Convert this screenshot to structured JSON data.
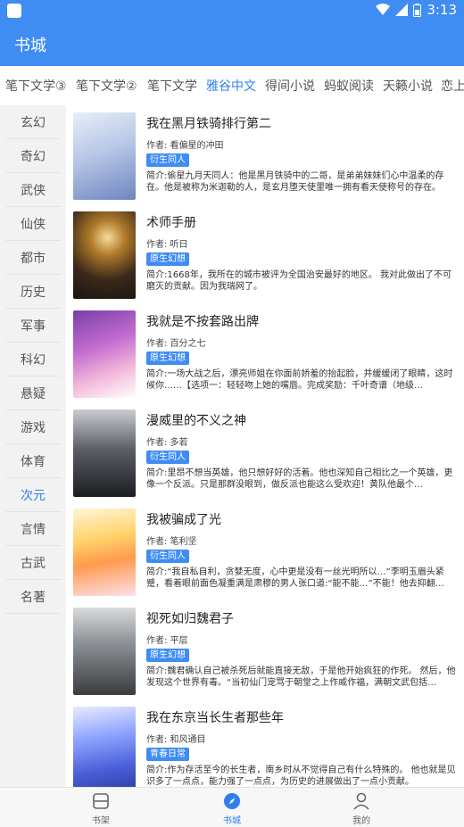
{
  "status": {
    "time": "3:13"
  },
  "header": {
    "title": "书城"
  },
  "tabs": [
    {
      "label": "笔下文学③"
    },
    {
      "label": "笔下文学②"
    },
    {
      "label": "笔下文学"
    },
    {
      "label": "雅谷中文"
    },
    {
      "label": "得间小说"
    },
    {
      "label": "蚂蚁阅读"
    },
    {
      "label": "天籁小说"
    },
    {
      "label": "恋上"
    }
  ],
  "sidebar": {
    "items": [
      {
        "label": "玄幻"
      },
      {
        "label": "奇幻"
      },
      {
        "label": "武侠"
      },
      {
        "label": "仙侠"
      },
      {
        "label": "都市"
      },
      {
        "label": "历史"
      },
      {
        "label": "军事"
      },
      {
        "label": "科幻"
      },
      {
        "label": "悬疑"
      },
      {
        "label": "游戏"
      },
      {
        "label": "体育"
      },
      {
        "label": "次元"
      },
      {
        "label": "言情"
      },
      {
        "label": "古武"
      },
      {
        "label": "名著"
      }
    ],
    "active_index": 11
  },
  "books": [
    {
      "title": "我在黑月铁骑排行第二",
      "author": "作者: 看偏星的冲田",
      "tag": "衍生同人",
      "desc": "简介:偷星九月天同人：他是黑月铁骑中的二哥，是弟弟妹妹们心中温柔的存在。他是被称为米迦勒的人，是玄月堕天使里唯一拥有看天使称号的存在。"
    },
    {
      "title": "术师手册",
      "author": "作者: 听日",
      "tag": "原生幻想",
      "desc": "简介:1668年，我所在的城市被评为全国治安最好的地区。 我对此做出了不可磨灭的贡献。因为我瑞网了。"
    },
    {
      "title": "我就是不按套路出牌",
      "author": "作者: 百分之七",
      "tag": "原生幻想",
      "desc": "简介:一场大战之后，漂亮师姐在你面前娇羞的抬起脸，并缓缓闭了眼睛，这时候你……【选项一：轻轻吻上她的嘴唇。完成奖励：千叶奇谱（地级…"
    },
    {
      "title": "漫威里的不义之神",
      "author": "作者: 多若",
      "tag": "衍生同人",
      "desc": "简介:里昂不想当英雄，他只想好好的活着。他也深知自己相比之一个英雄，更像一个反派。只是那群没眼到，做反派也能这么受欢迎！黄队他最个…"
    },
    {
      "title": "我被骗成了光",
      "author": "作者: 笔利坚",
      "tag": "衍生同人",
      "desc": "简介:“我自私自利，贪婪无度，心中更是没有一丝光明所以…”李明玉眉头紧蹙，看着眼前面色凝重满是肃穆的男人张口道:“能不能…”不能！他去抑翻…"
    },
    {
      "title": "视死如归魏君子",
      "author": "作者: 平层",
      "tag": "原生幻想",
      "desc": "简介:魏君确认自己被杀死后就能直接无敌，于是他开始疯狂的作死。 然后，他发现这个世界有毒。“当初仙门宠骂于朝堂之上作威作福，满朝文武包括…"
    },
    {
      "title": "我在东京当长生者那些年",
      "author": "作者: 和风通目",
      "tag": "青春日常",
      "desc": "简介:作为存活至今的长生者，南乡时从不觉得自己有什么特殊的。 他也就是见识多了一点点，能力强了一点点，为历史的进展做出了一点小贡献。"
    }
  ],
  "bottom_nav": [
    {
      "label": "书架"
    },
    {
      "label": "书城"
    },
    {
      "label": "我的"
    }
  ],
  "colors": {
    "accent": "#3f8cf3",
    "active_text": "#2f80ed"
  }
}
